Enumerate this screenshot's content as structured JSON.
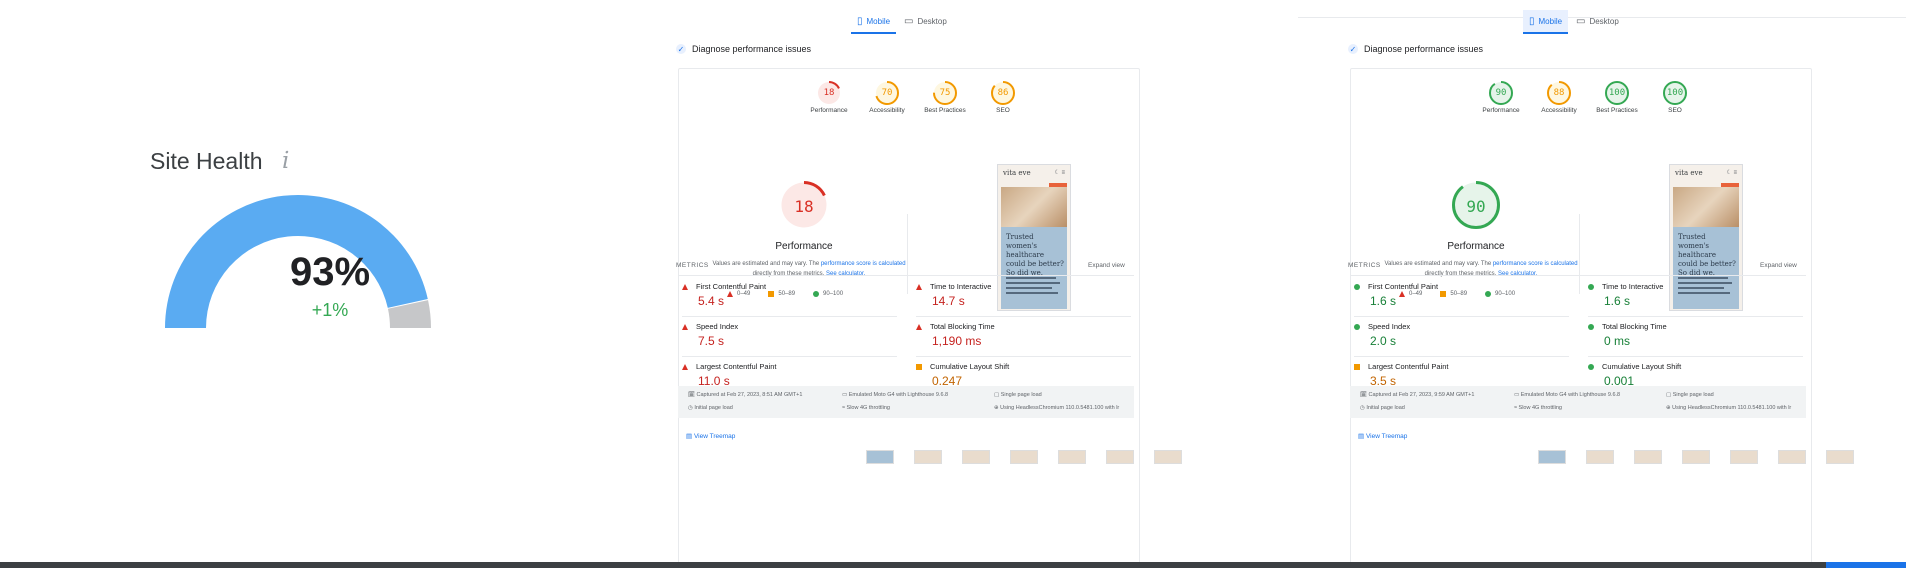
{
  "site_health": {
    "title": "Site Health",
    "info_glyph": "i",
    "percent": "93%",
    "percent_value": 93,
    "delta": "+1%",
    "colors": {
      "fill": "#5aabf2",
      "remainder": "#c6c7c9"
    }
  },
  "reports": [
    {
      "tabs": [
        {
          "label": "Mobile",
          "icon": "mobile-icon"
        },
        {
          "label": "Desktop",
          "icon": "desktop-icon"
        }
      ],
      "diagnose": "Diagnose performance issues",
      "categories": [
        {
          "score": "18",
          "label": "Performance",
          "value": 18,
          "color": "#d93025",
          "bg": "#fce8e6"
        },
        {
          "score": "70",
          "label": "Accessibility",
          "value": 70,
          "color": "#f29900",
          "bg": "#fef7e0"
        },
        {
          "score": "75",
          "label": "Best Practices",
          "value": 75,
          "color": "#f29900",
          "bg": "#fef7e0"
        },
        {
          "score": "86",
          "label": "SEO",
          "value": 86,
          "color": "#f29900",
          "bg": "#fef7e0"
        }
      ],
      "big": {
        "score": "18",
        "value": 18,
        "color": "#d93025",
        "bg": "#fce8e6",
        "title": "Performance"
      },
      "est_text": "Values are estimated and may vary. The",
      "est_link": "performance score is calculated",
      "est_text2": "directly from these metrics.",
      "est_link2": "See calculator.",
      "legend": [
        "0–49",
        "50–89",
        "90–100"
      ],
      "screenshot": {
        "logo": "vita eve",
        "headline": "Trusted women's healthcare could be better? So did we."
      },
      "metrics_label": "METRICS",
      "expand": "Expand view",
      "metrics": [
        {
          "name": "First Contentful Paint",
          "value": "5.4 s",
          "status": "poor"
        },
        {
          "name": "Time to Interactive",
          "value": "14.7 s",
          "status": "poor"
        },
        {
          "name": "Speed Index",
          "value": "7.5 s",
          "status": "poor"
        },
        {
          "name": "Total Blocking Time",
          "value": "1,190 ms",
          "status": "poor"
        },
        {
          "name": "Largest Contentful Paint",
          "value": "11.0 s",
          "status": "poor"
        },
        {
          "name": "Cumulative Layout Shift",
          "value": "0.247",
          "status": "average"
        }
      ],
      "info": {
        "captured": "Captured at Feb 27, 2023, 8:51 AM GMT+1",
        "initial": "Initial page load",
        "emulated": "Emulated Moto G4 with Lighthouse 9.6.8",
        "throttle": "Slow 4G throttling",
        "single": "Single page load",
        "using": "Using HeadlessChromium 110.0.5481.100 with lr"
      },
      "treemap": "View Treemap"
    },
    {
      "tabs": [
        {
          "label": "Mobile",
          "icon": "mobile-icon"
        },
        {
          "label": "Desktop",
          "icon": "desktop-icon"
        }
      ],
      "diagnose": "Diagnose performance issues",
      "categories": [
        {
          "score": "90",
          "label": "Performance",
          "value": 90,
          "color": "#34a853",
          "bg": "#e6f4ea"
        },
        {
          "score": "88",
          "label": "Accessibility",
          "value": 88,
          "color": "#f29900",
          "bg": "#fef7e0"
        },
        {
          "score": "100",
          "label": "Best Practices",
          "value": 100,
          "color": "#34a853",
          "bg": "#e6f4ea"
        },
        {
          "score": "100",
          "label": "SEO",
          "value": 100,
          "color": "#34a853",
          "bg": "#e6f4ea"
        }
      ],
      "big": {
        "score": "90",
        "value": 90,
        "color": "#34a853",
        "bg": "#e6f4ea",
        "title": "Performance"
      },
      "est_text": "Values are estimated and may vary. The",
      "est_link": "performance score is calculated",
      "est_text2": "directly from these metrics.",
      "est_link2": "See calculator.",
      "legend": [
        "0–49",
        "50–89",
        "90–100"
      ],
      "screenshot": {
        "logo": "vita eve",
        "headline": "Trusted women's healthcare could be better? So did we."
      },
      "metrics_label": "METRICS",
      "expand": "Expand view",
      "metrics": [
        {
          "name": "First Contentful Paint",
          "value": "1.6 s",
          "status": "good"
        },
        {
          "name": "Time to Interactive",
          "value": "1.6 s",
          "status": "good"
        },
        {
          "name": "Speed Index",
          "value": "2.0 s",
          "status": "good"
        },
        {
          "name": "Total Blocking Time",
          "value": "0 ms",
          "status": "good"
        },
        {
          "name": "Largest Contentful Paint",
          "value": "3.5 s",
          "status": "average"
        },
        {
          "name": "Cumulative Layout Shift",
          "value": "0.001",
          "status": "good"
        }
      ],
      "info": {
        "captured": "Captured at Feb 27, 2023, 9:59 AM GMT+1",
        "initial": "Initial page load",
        "emulated": "Emulated Moto G4 with Lighthouse 9.6.8",
        "throttle": "Slow 4G throttling",
        "single": "Single page load",
        "using": "Using HeadlessChromium 110.0.5481.100 with lr"
      },
      "treemap": "View Treemap"
    }
  ]
}
